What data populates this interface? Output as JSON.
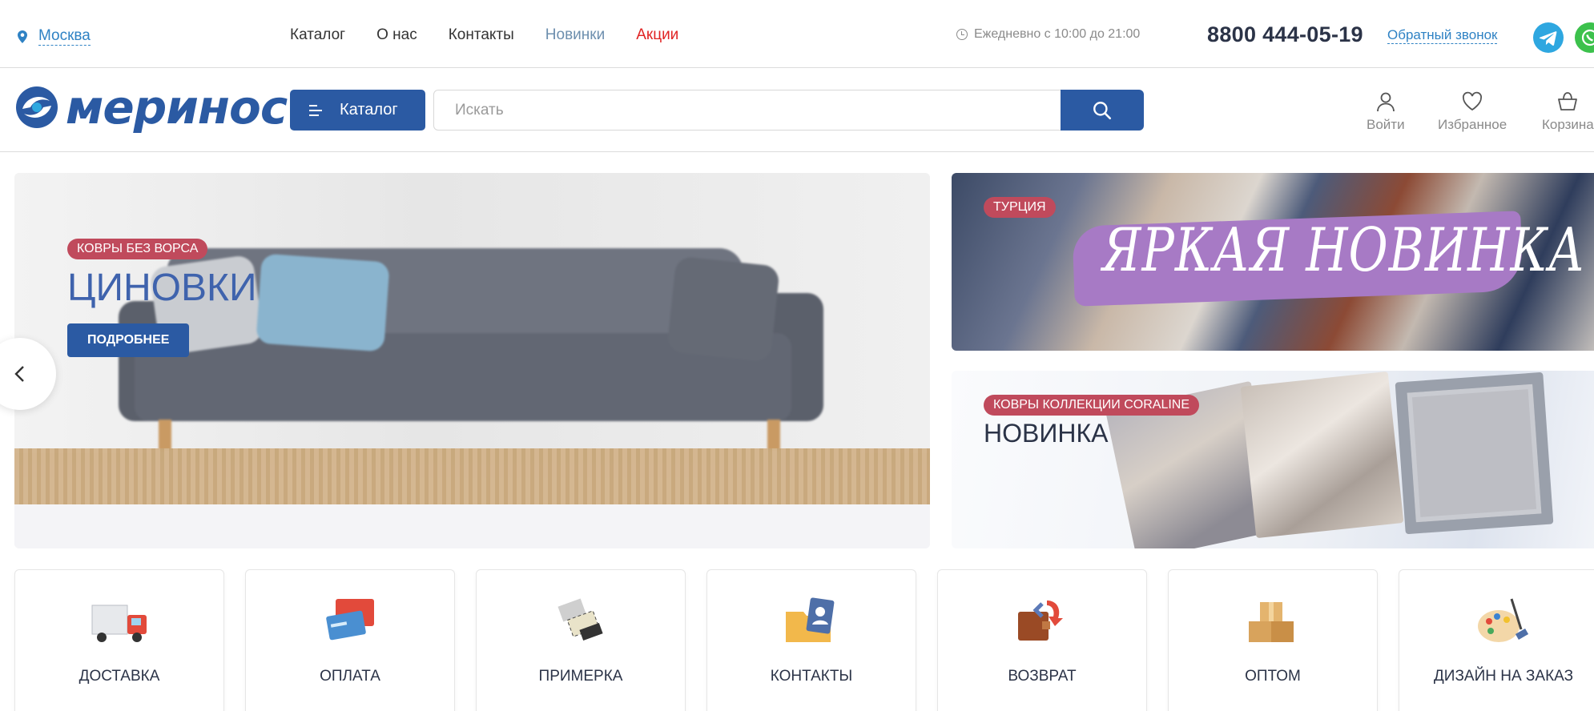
{
  "topbar": {
    "city": "Москва",
    "nav": [
      "Каталог",
      "О нас",
      "Контакты",
      "Новинки",
      "Акции"
    ],
    "hours": "Ежедневно с 10:00 до 21:00",
    "phone": "8800 444-05-19",
    "callback": "Обратный звонок"
  },
  "header": {
    "logo_text": "меринос",
    "catalog_button": "Каталог",
    "search_placeholder": "Искать",
    "login": "Войти",
    "favorites": "Избранное",
    "cart": "Корзина"
  },
  "main_banner": {
    "tag": "КОВРЫ БЕЗ ВОРСА",
    "title": "ЦИНОВКИ",
    "button": "ПОДРОБНЕЕ"
  },
  "side_banner_1": {
    "tag": "ТУРЦИЯ",
    "headline": "ЯРКАЯ НОВИНКА"
  },
  "side_banner_2": {
    "tag": "КОВРЫ КОЛЛЕКЦИИ CORALINE",
    "title": "НОВИНКА"
  },
  "services": [
    {
      "label": "ДОСТАВКА",
      "icon": "truck-icon"
    },
    {
      "label": "ОПЛАТА",
      "icon": "wallet-icon"
    },
    {
      "label": "ПРИМЕРКА",
      "icon": "rug-samples-icon"
    },
    {
      "label": "КОНТАКТЫ",
      "icon": "contacts-folder-icon"
    },
    {
      "label": "ВОЗВРАТ",
      "icon": "return-wallet-icon"
    },
    {
      "label": "ОПТОМ",
      "icon": "boxes-icon"
    },
    {
      "label": "ДИЗАЙН НА ЗАКАЗ",
      "icon": "palette-icon"
    }
  ],
  "colors": {
    "brand_blue": "#2b5aa3",
    "link_blue": "#2f82c4",
    "sale_red": "#e02323",
    "tag_red": "#c04a5c",
    "purple": "#a77ac5"
  }
}
